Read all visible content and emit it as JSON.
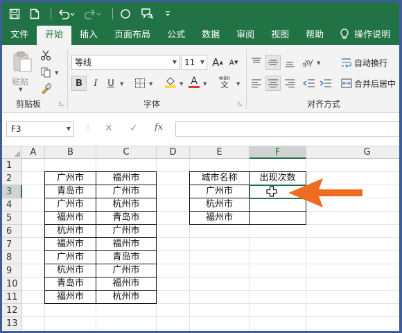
{
  "ribbon_tabs": [
    "文件",
    "开始",
    "插入",
    "页面布局",
    "公式",
    "数据",
    "审阅",
    "视图",
    "帮助",
    "操作说明"
  ],
  "active_tab": "开始",
  "clipboard": {
    "paste_label": "粘贴",
    "group_label": "剪贴板"
  },
  "font": {
    "name": "等线",
    "size": "11",
    "group_label": "字体",
    "bold": "B",
    "italic": "I",
    "underline": "U",
    "grow": "A",
    "shrink": "A",
    "color_glyph": "A",
    "phonetic": "wén"
  },
  "alignment": {
    "wrap_text": "自动换行",
    "merge_center": "合并后居中",
    "group_label": "对齐方式"
  },
  "formula_bar": {
    "name_box": "F3",
    "formula": "",
    "fx": "fx"
  },
  "columns": [
    "A",
    "B",
    "C",
    "D",
    "E",
    "F",
    "G"
  ],
  "selected_column": "F",
  "rows": [
    "1",
    "2",
    "3",
    "4",
    "5",
    "6",
    "7",
    "8",
    "9",
    "10",
    "11",
    "12",
    "13"
  ],
  "selected_row": "3",
  "cells": {
    "B": [
      "广州市",
      "青岛市",
      "广州市",
      "福州市",
      "杭州市",
      "福州市",
      "广州市",
      "杭州市",
      "青岛市",
      "福州市"
    ],
    "C": [
      "福州市",
      "广州市",
      "杭州市",
      "青岛市",
      "广州市",
      "福州市",
      "青岛市",
      "广州市",
      "福州市",
      "杭州市"
    ],
    "E": [
      "城市名称",
      "广州市",
      "杭州市",
      "福州市"
    ],
    "F": [
      "出现次数",
      "",
      "",
      ""
    ]
  },
  "colors": {
    "excel_green": "#217346",
    "annotation_arrow": "#ee6c1f",
    "frame": "#3d5c99"
  }
}
